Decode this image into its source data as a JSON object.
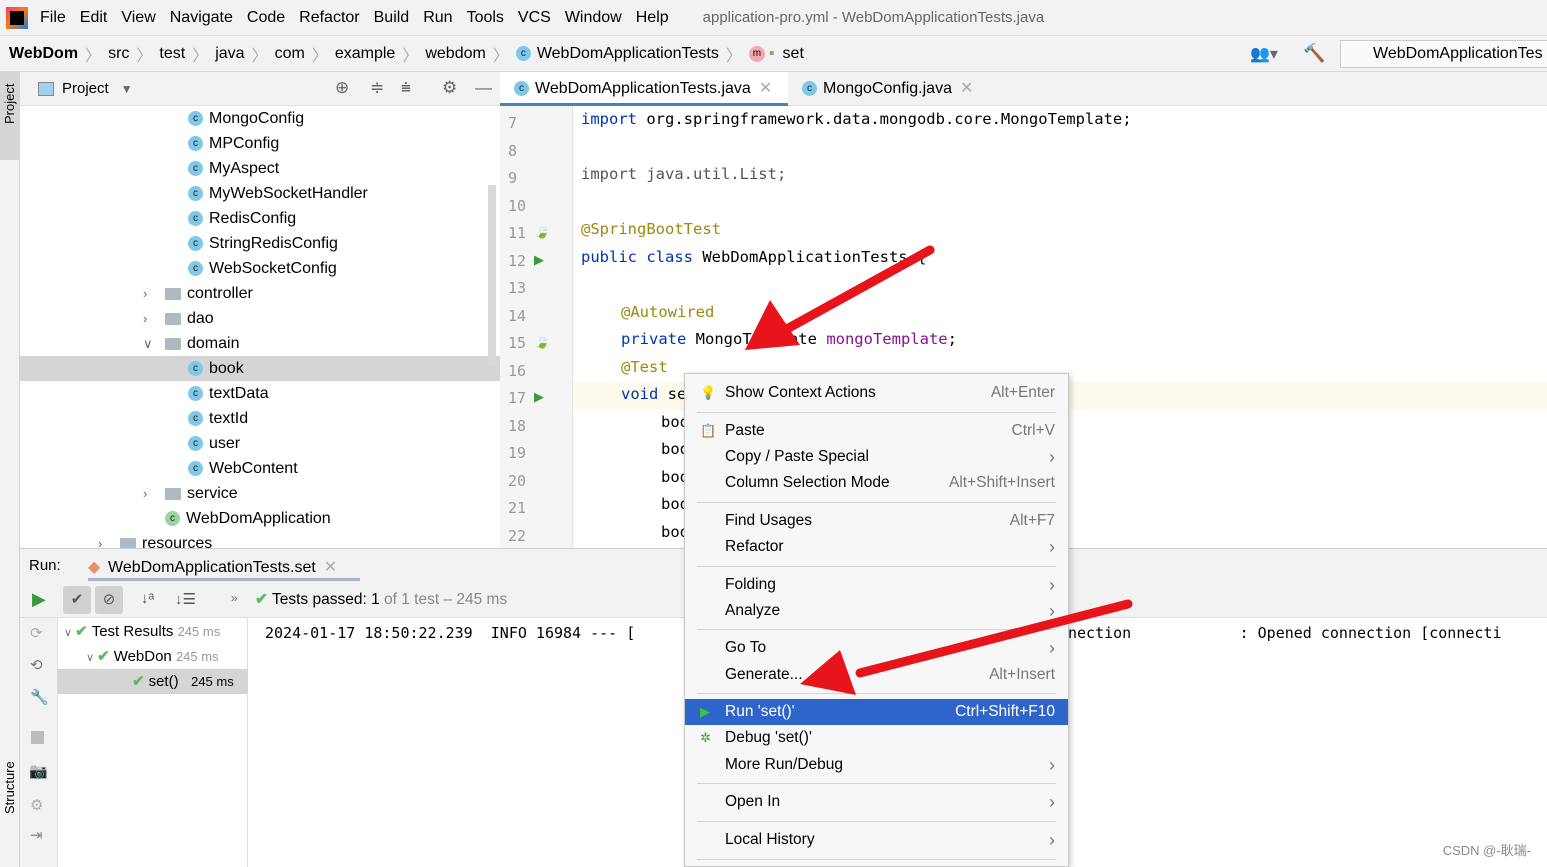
{
  "menubar": {
    "items": [
      "File",
      "Edit",
      "View",
      "Navigate",
      "Code",
      "Refactor",
      "Build",
      "Run",
      "Tools",
      "VCS",
      "Window",
      "Help"
    ],
    "title": "application-pro.yml - WebDomApplicationTests.java"
  },
  "breadcrumb": {
    "items": [
      "WebDom",
      "src",
      "test",
      "java",
      "com",
      "example",
      "webdom",
      "WebDomApplicationTests",
      "set"
    ],
    "run_config": "WebDomApplicationTes"
  },
  "left_strip": {
    "project": "Project",
    "structure": "Structure"
  },
  "project": {
    "title": "Project",
    "tree": [
      {
        "label": "MongoConfig",
        "type": "class",
        "depth": 3
      },
      {
        "label": "MPConfig",
        "type": "class",
        "depth": 3
      },
      {
        "label": "MyAspect",
        "type": "class",
        "depth": 3
      },
      {
        "label": "MyWebSocketHandler",
        "type": "class",
        "depth": 3
      },
      {
        "label": "RedisConfig",
        "type": "class",
        "depth": 3
      },
      {
        "label": "StringRedisConfig",
        "type": "class",
        "depth": 3
      },
      {
        "label": "WebSocketConfig",
        "type": "class",
        "depth": 3
      },
      {
        "label": "controller",
        "type": "folder",
        "depth": 2,
        "expanded": false
      },
      {
        "label": "dao",
        "type": "folder",
        "depth": 2,
        "expanded": false
      },
      {
        "label": "domain",
        "type": "folder",
        "depth": 2,
        "expanded": true
      },
      {
        "label": "book",
        "type": "class",
        "depth": 3,
        "selected": true
      },
      {
        "label": "textData",
        "type": "class",
        "depth": 3
      },
      {
        "label": "textId",
        "type": "class",
        "depth": 3
      },
      {
        "label": "user",
        "type": "class",
        "depth": 3
      },
      {
        "label": "WebContent",
        "type": "class",
        "depth": 3
      },
      {
        "label": "service",
        "type": "folder",
        "depth": 2,
        "expanded": false
      },
      {
        "label": "WebDomApplication",
        "type": "app",
        "depth": 2
      },
      {
        "label": "resources",
        "type": "folder",
        "depth": 1,
        "expanded": false
      }
    ]
  },
  "editor": {
    "tabs": [
      {
        "label": "WebDomApplicationTests.java",
        "active": true
      },
      {
        "label": "MongoConfig.java",
        "active": false
      }
    ],
    "line_numbers": [
      "7",
      "8",
      "9",
      "10",
      "11",
      "12",
      "13",
      "14",
      "15",
      "16",
      "17",
      "18",
      "19",
      "20",
      "21",
      "22"
    ],
    "lines": {
      "l7a": "import ",
      "l7b": "org.springframework.data.mongodb.core.MongoTemplate;",
      "l9": "import java.util.List;",
      "l11": "@SpringBootTest",
      "l12a": "public class ",
      "l12b": "WebDomApplicationTests {",
      "l14": "@Autowired",
      "l15a": "private ",
      "l15b": "MongoTemplate ",
      "l15c": "mongoTemplate",
      "l15d": ";",
      "l16": "@Test",
      "l17a": "void ",
      "l17b": "se",
      "bo": "boo"
    }
  },
  "run": {
    "label": "Run:",
    "tab": "WebDomApplicationTests.set",
    "status_prefix": "Tests passed: ",
    "status_count": "1",
    "status_suffix": " of 1 test – 245 ms",
    "tree": [
      {
        "label": "Test Results",
        "time": "245 ms"
      },
      {
        "label": "WebDon",
        "time": "245 ms"
      },
      {
        "label": "set()",
        "time": "245 ms"
      }
    ],
    "console_left": "2024-01-17 18:50:22.239  INFO 16984 --- [",
    "console_right": "nection            : Opened connection [connecti"
  },
  "context_menu": {
    "items": [
      {
        "label": "Show Context Actions",
        "shortcut": "Alt+Enter",
        "icon": "bulb-icon"
      },
      {
        "label": "Paste",
        "shortcut": "Ctrl+V",
        "icon": "clipboard-icon"
      },
      {
        "label": "Copy / Paste Special",
        "submenu": true
      },
      {
        "label": "Column Selection Mode",
        "shortcut": "Alt+Shift+Insert"
      },
      {
        "label": "Find Usages",
        "shortcut": "Alt+F7"
      },
      {
        "label": "Refactor",
        "submenu": true
      },
      {
        "label": "Folding",
        "submenu": true
      },
      {
        "label": "Analyze",
        "submenu": true
      },
      {
        "label": "Go To",
        "submenu": true
      },
      {
        "label": "Generate...",
        "shortcut": "Alt+Insert"
      },
      {
        "label": "Run 'set()'",
        "shortcut": "Ctrl+Shift+F10",
        "icon": "run-icon",
        "highlighted": true
      },
      {
        "label": "Debug 'set()'",
        "icon": "debug-icon"
      },
      {
        "label": "More Run/Debug",
        "submenu": true
      },
      {
        "label": "Open In",
        "submenu": true
      },
      {
        "label": "Local History",
        "submenu": true
      }
    ]
  },
  "colors": {
    "highlight": "#2f65ca",
    "arrow": "#e8141b",
    "pass": "#5fb85f"
  },
  "watermark": "CSDN @-耿瑞-"
}
